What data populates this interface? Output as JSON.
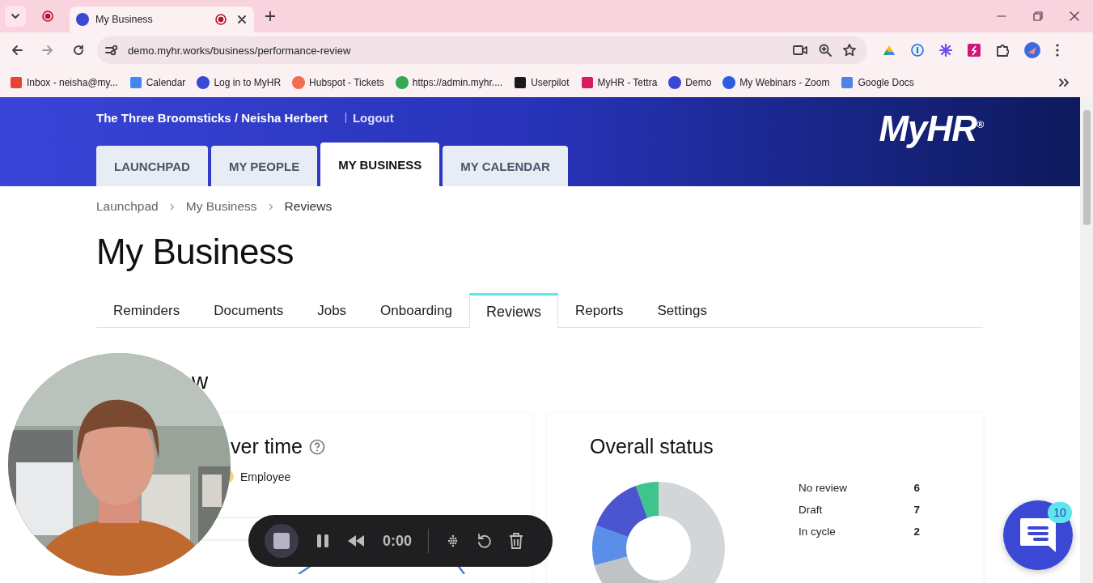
{
  "browser": {
    "tabs": [
      {
        "title": "My Business",
        "selected": true,
        "recording": true
      }
    ],
    "address": "demo.myhr.works/business/performance-review",
    "bookmarks": [
      {
        "label": "Inbox - neisha@my...",
        "color": "#ea4335",
        "kind": "square"
      },
      {
        "label": "Calendar",
        "color": "#4285f4",
        "kind": "square"
      },
      {
        "label": "Log in to MyHR",
        "color": "#3b48d4",
        "kind": "circle"
      },
      {
        "label": "Hubspot - Tickets",
        "color": "#f26c4f",
        "kind": "circle"
      },
      {
        "label": "https://admin.myhr....",
        "color": "#34a853",
        "kind": "circle"
      },
      {
        "label": "Userpilot",
        "color": "#1a1a1a",
        "kind": "square"
      },
      {
        "label": "MyHR - Tettra",
        "color": "#d81b60",
        "kind": "square"
      },
      {
        "label": "Demo",
        "color": "#3b48d4",
        "kind": "circle"
      },
      {
        "label": "My Webinars - Zoom",
        "color": "#2d5be3",
        "kind": "circle"
      },
      {
        "label": "Google Docs",
        "color": "#4a86e8",
        "kind": "square"
      }
    ]
  },
  "header": {
    "account": "The Three Broomsticks / Neisha Herbert",
    "logout": "Logout",
    "logo": "MyHR$^{®}$",
    "tabs": [
      {
        "label": "LAUNCHPAD",
        "selected": false
      },
      {
        "label": "MY PEOPLE",
        "selected": false
      },
      {
        "label": "MY BUSINESS",
        "selected": true
      },
      {
        "label": "MY CALENDAR",
        "selected": false
      }
    ]
  },
  "breadcrumb": [
    "Launchpad",
    "My Business",
    "Reviews"
  ],
  "title": "My Business",
  "subtabs": [
    {
      "label": "Reminders",
      "selected": false
    },
    {
      "label": "Documents",
      "selected": false
    },
    {
      "label": "Jobs",
      "selected": false
    },
    {
      "label": "Onboarding",
      "selected": false
    },
    {
      "label": "Reviews",
      "selected": true
    },
    {
      "label": "Reports",
      "selected": false
    },
    {
      "label": "Settings",
      "selected": false
    }
  ],
  "section_heading": "w",
  "left_card": {
    "title": "ver time",
    "legend": [
      {
        "label": "Employee",
        "color": "#f5d77a"
      }
    ]
  },
  "right_card": {
    "title": "Overall status",
    "legend": [
      {
        "label": "No review",
        "count": "6"
      },
      {
        "label": "Draft",
        "count": "7"
      },
      {
        "label": "In cycle",
        "count": "2"
      }
    ]
  },
  "recorder": {
    "time": "0:00"
  },
  "chat": {
    "badge": "10"
  }
}
